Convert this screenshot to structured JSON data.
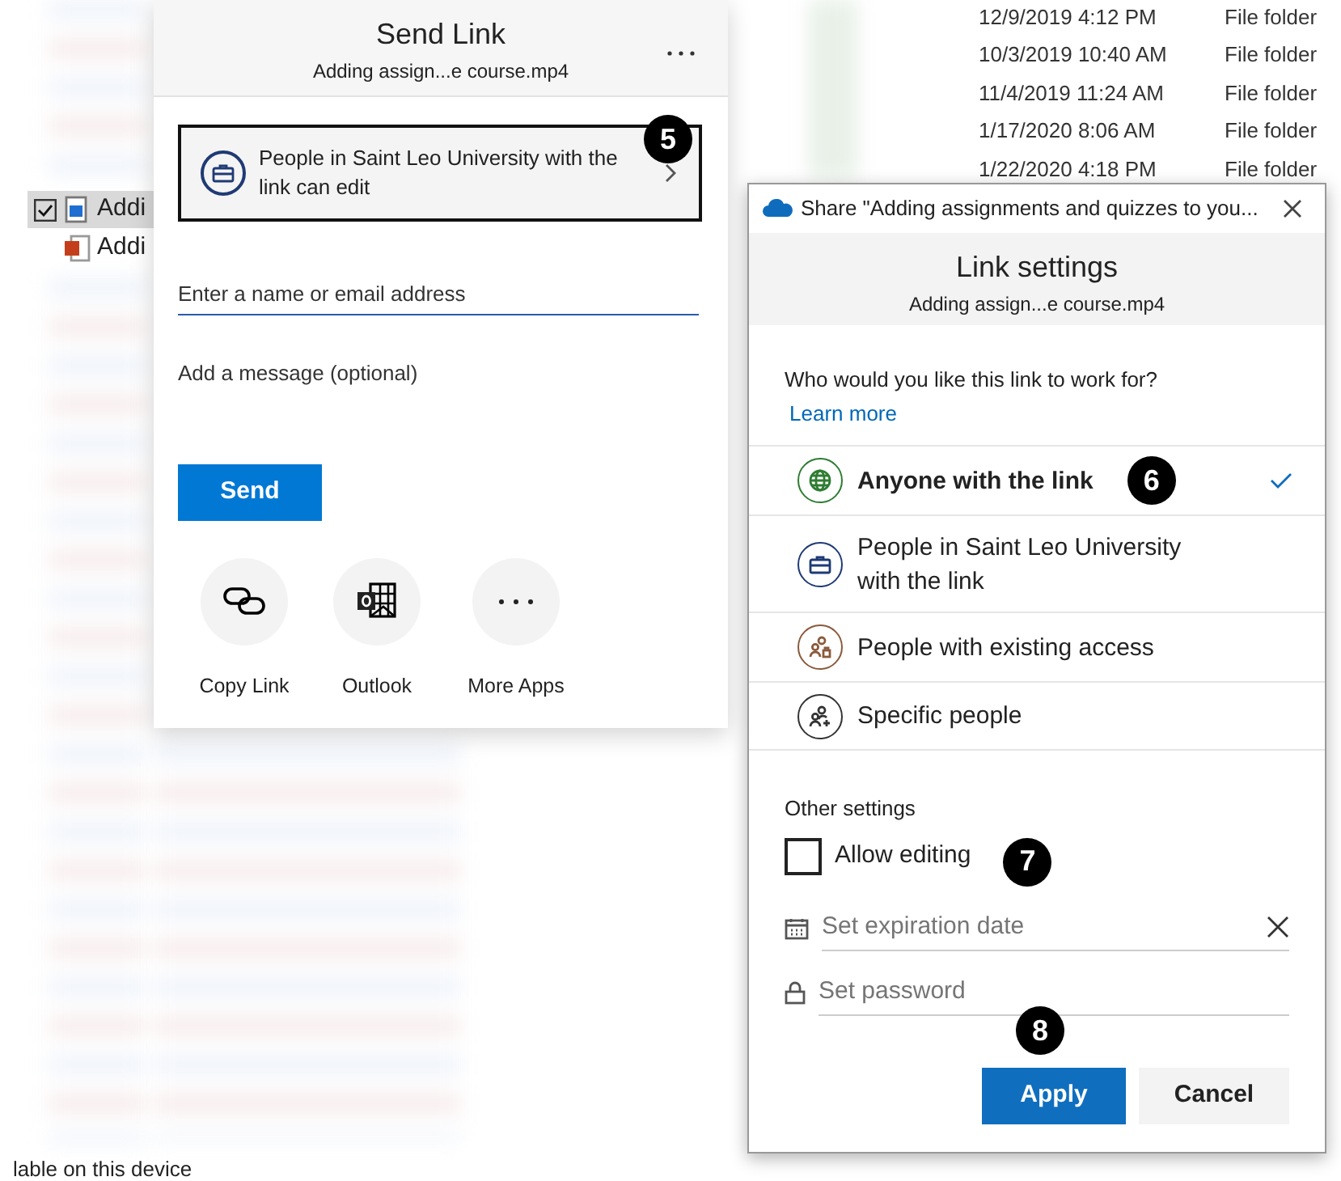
{
  "explorer": {
    "rows": [
      {
        "date": "12/9/2019 4:12 PM",
        "type": "File folder"
      },
      {
        "date": "10/3/2019 10:40 AM",
        "type": "File folder"
      },
      {
        "date": "11/4/2019 11:24 AM",
        "type": "File folder"
      },
      {
        "date": "1/17/2020 8:06 AM",
        "type": "File folder"
      },
      {
        "date": "1/22/2020 4:18 PM",
        "type": "File folder"
      }
    ],
    "files": [
      {
        "name": "Addi",
        "kind": "video",
        "checked": true,
        "selected": true
      },
      {
        "name": "Addi",
        "kind": "powerpoint",
        "checked": false,
        "selected": false
      }
    ],
    "status_text": "lable on this device"
  },
  "send_link": {
    "title": "Send Link",
    "subtitle": "Adding assign...e course.mp4",
    "permission": {
      "text": "People in Saint Leo University with the link can edit",
      "callout": "5"
    },
    "recipient_placeholder": "Enter a name or email address",
    "message_placeholder": "Add a message (optional)",
    "send_button": "Send",
    "apps": [
      {
        "label": "Copy Link",
        "kind": "link"
      },
      {
        "label": "Outlook",
        "kind": "outlook"
      },
      {
        "label": "More Apps",
        "kind": "more"
      }
    ]
  },
  "share_dialog": {
    "title": "Share \"Adding assignments and quizzes to you...",
    "heading": "Link settings",
    "subtitle": "Adding assign...e course.mp4",
    "question": "Who would you like this link to work for?",
    "learn_more": "Learn more",
    "options": [
      {
        "label": "Anyone with the link",
        "kind": "globe",
        "color": "#2e7d32",
        "selected": true,
        "callout": "6"
      },
      {
        "label": "People in Saint Leo University with the link",
        "kind": "briefcase",
        "color": "#1f3a75",
        "selected": false
      },
      {
        "label": "People with existing access",
        "kind": "people-lock",
        "color": "#8a5a3c",
        "selected": false
      },
      {
        "label": "Specific people",
        "kind": "people-add",
        "color": "#333333",
        "selected": false
      }
    ],
    "other_settings": "Other settings",
    "allow_editing": {
      "label": "Allow editing",
      "checked": false,
      "callout": "7"
    },
    "expiration_placeholder": "Set expiration date",
    "password_placeholder": "Set password",
    "buttons_callout": "8",
    "buttons": [
      {
        "label": "Apply",
        "kind": "primary"
      },
      {
        "label": "Cancel",
        "kind": "secondary"
      }
    ]
  }
}
